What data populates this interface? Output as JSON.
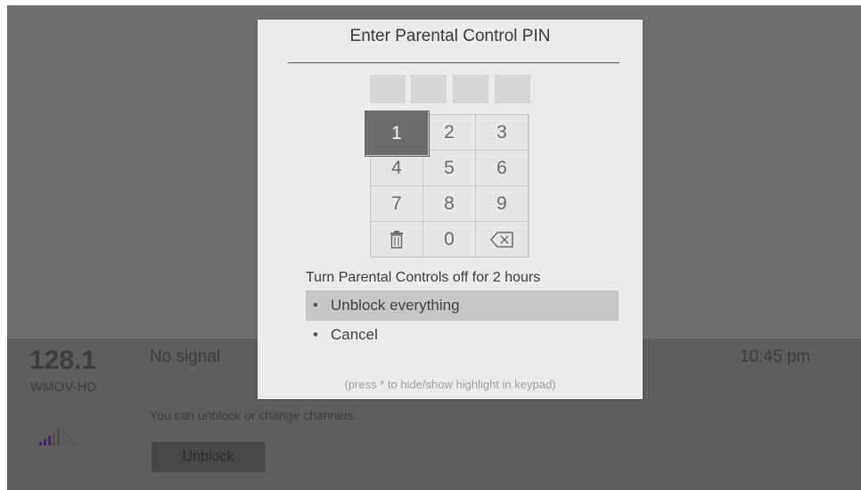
{
  "dialog": {
    "title": "Enter Parental Control PIN",
    "pin_boxes": [
      "",
      "",
      "",
      ""
    ],
    "keypad": {
      "keys": [
        {
          "label": "1",
          "selected": true
        },
        {
          "label": "2"
        },
        {
          "label": "3"
        },
        {
          "label": "4"
        },
        {
          "label": "5"
        },
        {
          "label": "6"
        },
        {
          "label": "7"
        },
        {
          "label": "8"
        },
        {
          "label": "9"
        },
        {
          "label": "",
          "icon": "trash-icon"
        },
        {
          "label": "0"
        },
        {
          "label": "",
          "icon": "backspace-icon"
        }
      ]
    },
    "timeout_label": "Turn Parental Controls off for 2 hours",
    "options": [
      {
        "label": "Unblock everything",
        "highlighted": true
      },
      {
        "label": "Cancel"
      }
    ],
    "hint": "(press * to hide/show highlight in keypad)"
  },
  "info_bar": {
    "channel_number": "128.1",
    "channel_name": "WMOV-HD",
    "status": "No signal",
    "time": "10:45 pm",
    "message": "You can unblock or change channels.",
    "unblock_button": "Unblock"
  },
  "colors": {
    "screen_bg": "#6f6f6f",
    "dialog_bg": "#ebebeb",
    "selected_key": "#6b6b6b",
    "highlight_option": "#c6c6c6",
    "signal_bars": "#5a2a8a"
  }
}
